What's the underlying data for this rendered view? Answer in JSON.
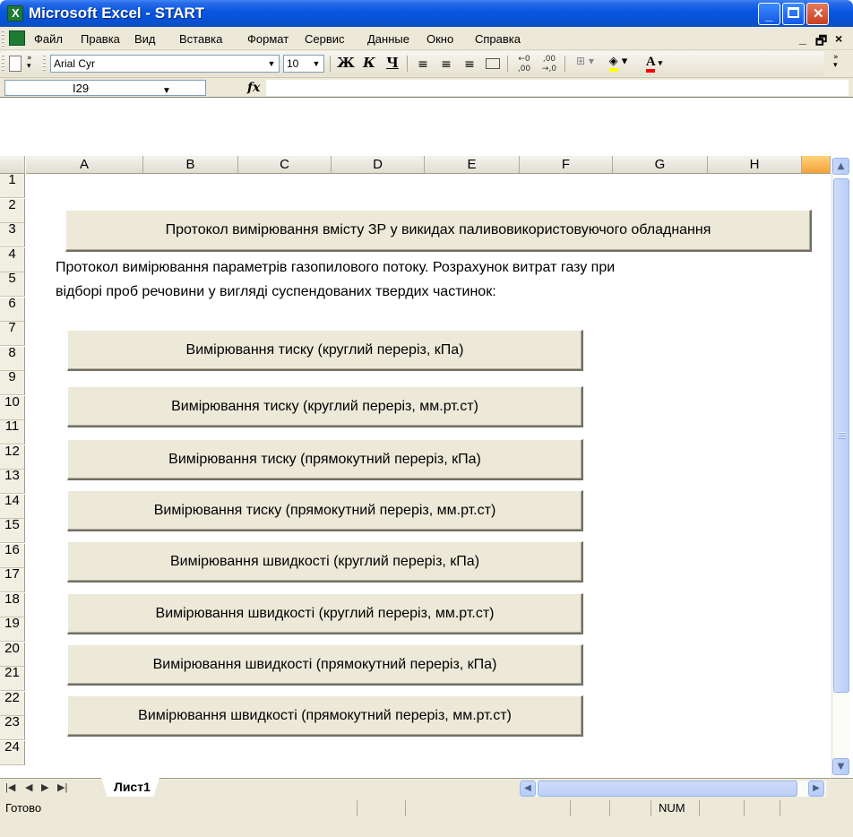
{
  "window": {
    "title": "Microsoft Excel - START"
  },
  "menu": {
    "items": [
      {
        "label": "Файл"
      },
      {
        "label": "Правка"
      },
      {
        "label": "Вид"
      },
      {
        "label": "Вставка"
      },
      {
        "label": "Формат"
      },
      {
        "label": "Сервис"
      },
      {
        "label": "Данные"
      },
      {
        "label": "Окно"
      },
      {
        "label": "Справка"
      }
    ]
  },
  "toolbar": {
    "font_name": "Arial Cyr",
    "font_size": "10",
    "bold": "Ж",
    "italic": "К",
    "underline": "Ч"
  },
  "formula_bar": {
    "cell_ref": "I29",
    "fx": "fx",
    "formula": ""
  },
  "columns": [
    "A",
    "B",
    "C",
    "D",
    "E",
    "F",
    "G",
    "H"
  ],
  "rows": [
    "1",
    "2",
    "3",
    "4",
    "5",
    "6",
    "7",
    "8",
    "9",
    "10",
    "11",
    "12",
    "13",
    "14",
    "15",
    "16",
    "17",
    "18",
    "19",
    "20",
    "21",
    "22",
    "23",
    "24"
  ],
  "sheet": {
    "top_button": "Протокол вимірювання вмісту ЗР у викидах паливовикористовуючого обладнання",
    "description_line1": "Протокол вимірювання параметрів газопилового потоку. Розрахунок витрат газу при",
    "description_line2": "відборі проб речовини у вигляді суспендованих твердих частинок:",
    "buttons": [
      "Вимірювання тиску (круглий переріз, кПа)",
      "Вимірювання тиску (круглий переріз, мм.рт.ст)",
      "Вимірювання тиску (прямокутний переріз, кПа)",
      "Вимірювання тиску (прямокутний переріз, мм.рт.ст)",
      "Вимірювання швидкості (круглий переріз, кПа)",
      "Вимірювання швидкості (круглий переріз, мм.рт.ст)",
      "Вимірювання швидкості (прямокутний переріз, кПа)",
      "Вимірювання швидкості (прямокутний переріз, мм.рт.ст)"
    ]
  },
  "tabs": {
    "active": "Лист1"
  },
  "status": {
    "text": "Готово",
    "num": "NUM"
  }
}
